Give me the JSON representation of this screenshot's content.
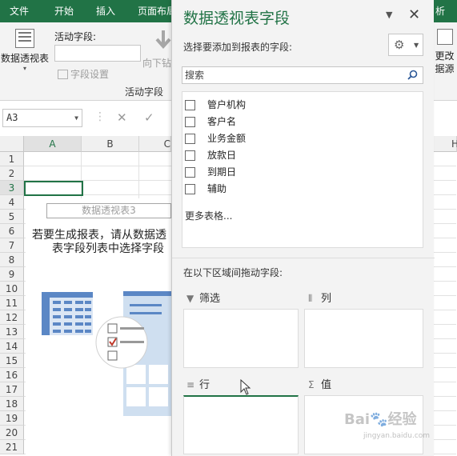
{
  "ribbon": {
    "tabs": [
      "文件",
      "开始",
      "插入",
      "页面布局",
      "析"
    ],
    "pivot_table_button": "数据透视表",
    "active_field_label": "活动字段:",
    "active_field_value": "",
    "field_settings": "字段设置",
    "drill_down": "向下钻",
    "group_label": "活动字段",
    "change_source_line1": "更改",
    "change_source_line2": "据源"
  },
  "formula_bar": {
    "cell_ref": "A3",
    "cancel_glyph": "✕",
    "enter_glyph": "✓"
  },
  "sheet": {
    "columns": [
      "A",
      "B",
      "C",
      "H"
    ],
    "rows": [
      "1",
      "2",
      "3",
      "4",
      "5",
      "6",
      "7",
      "8",
      "9",
      "10",
      "11",
      "12",
      "13",
      "14",
      "15",
      "16",
      "17",
      "18",
      "19",
      "20",
      "21"
    ],
    "selected_row": "3",
    "pivot_title": "数据透视表3",
    "pivot_msg_line1": "若要生成报表，请从数据透",
    "pivot_msg_line2": "表字段列表中选择字段"
  },
  "pane": {
    "title": "数据透视表字段",
    "choose_label": "选择要添加到报表的字段:",
    "search_placeholder": "搜索",
    "fields": [
      "管户机构",
      "客户名",
      "业务金额",
      "放款日",
      "到期日",
      "辅助"
    ],
    "more_tables": "更多表格...",
    "drag_label": "在以下区域间拖动字段:",
    "areas": {
      "filters": "筛选",
      "columns": "列",
      "rows": "行",
      "values": "值"
    }
  },
  "watermark": {
    "brand": "Bai",
    "brand2": "经验",
    "url": "jingyan.baidu.com"
  },
  "colors": {
    "accent": "#217346",
    "pane_bg": "#f3f3f3"
  }
}
